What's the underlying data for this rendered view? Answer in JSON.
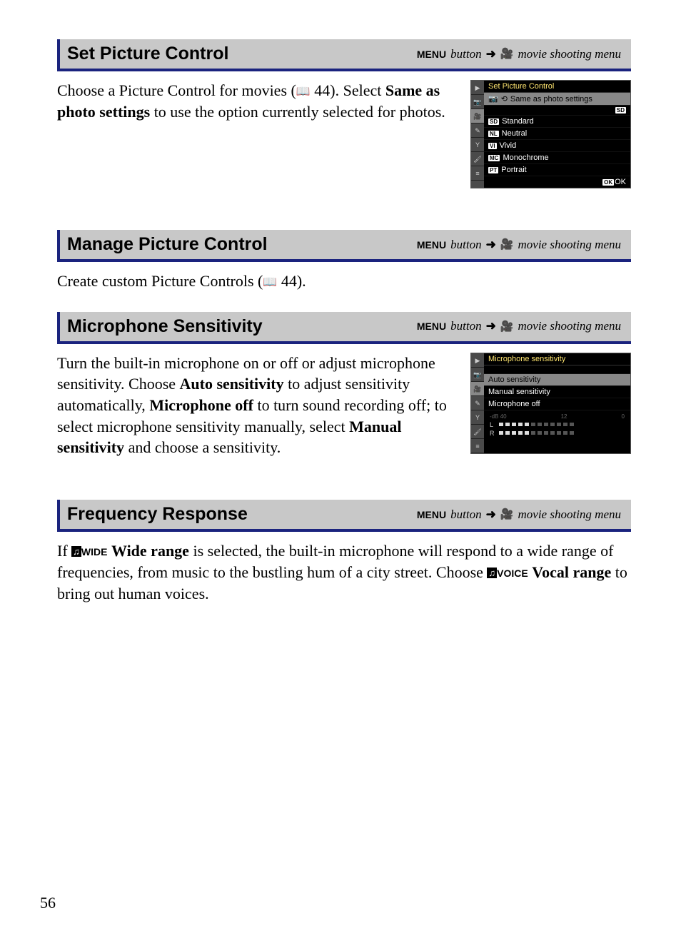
{
  "menu_path_label": "MENU",
  "menu_path_button": "button",
  "menu_path_name": "movie shooting menu",
  "page_number": "56",
  "sections": {
    "set_picture": {
      "title": "Set Picture Control",
      "text_a": "Choose a Picture Control for movies (",
      "ref": " 44).",
      "text_b": "Select ",
      "bold_b": "Same as photo settings",
      "text_c": " to use the option currently selected for photos.",
      "scr_title": "Set Picture Control",
      "scr_items": {
        "same": "Same as photo settings",
        "sd_badge": "SD",
        "standard": "Standard",
        "neutral": "Neutral",
        "vivid": "Vivid",
        "mono": "Monochrome",
        "portrait": "Portrait"
      },
      "scr_right_badge": "SD",
      "scr_ok": "OK"
    },
    "manage": {
      "title": "Manage Picture Control",
      "text_a": "Create custom Picture Controls (",
      "ref": " 44)."
    },
    "mic": {
      "title": "Microphone Sensitivity",
      "text_a": "Turn the built-in microphone on or off or adjust microphone sensitivity.  Choose ",
      "bold_a": "Auto sensitivity",
      "text_b": " to adjust sensitivity automatically, ",
      "bold_b": "Microphone off",
      "text_c": " to turn sound recording off; to select microphone sensitivity manually, select ",
      "bold_c": "Manual sensitivity",
      "text_d": " and choose a sensitivity.",
      "scr_title": "Microphone sensitivity",
      "scr_items": {
        "auto": "Auto sensitivity",
        "manual": "Manual sensitivity",
        "off": "Microphone off"
      },
      "scale": {
        "a": "-dB 40",
        "b": "12",
        "c": "0"
      },
      "l": "L",
      "r": "R"
    },
    "freq": {
      "title": "Frequency Response",
      "text_a": "If ",
      "wide_label": "WIDE",
      "bold_a": "Wide range",
      "text_b": " is selected, the built-in microphone will respond to a wide range of frequencies, from music to the bustling hum of a city street.  Choose ",
      "voice_label": "VOICE",
      "bold_b": "Vocal range",
      "text_c": " to bring out human voices."
    }
  }
}
